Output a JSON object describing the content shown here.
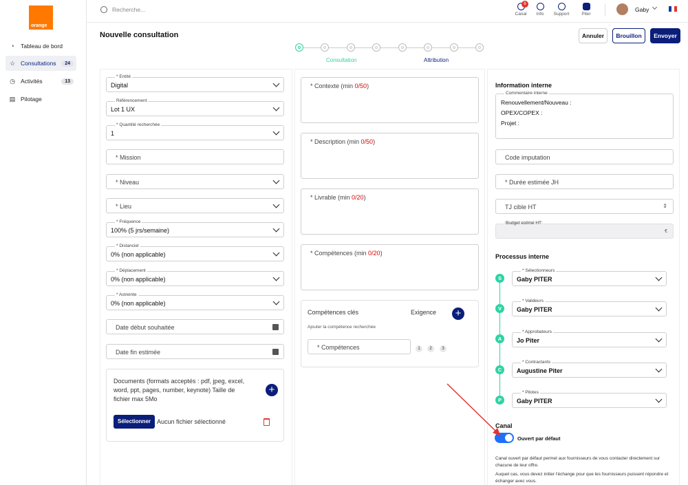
{
  "brand": {
    "logo_text": "orange",
    "color": "#ff7900"
  },
  "sidebar": {
    "items": [
      {
        "label": "Tableau de bord",
        "count": "",
        "icon": "gauge-icon"
      },
      {
        "label": "Consultations",
        "count": "24",
        "icon": "star-icon"
      },
      {
        "label": "Activités",
        "count": "13",
        "icon": "clock-icon"
      },
      {
        "label": "Pilotage",
        "count": "",
        "icon": "document-icon"
      }
    ]
  },
  "topbar": {
    "search_placeholder": "Recherche...",
    "icons": [
      {
        "label": "Canal",
        "badge": "6"
      },
      {
        "label": "Info"
      },
      {
        "label": "Support"
      },
      {
        "label": "Piter"
      }
    ],
    "user": "Gaby"
  },
  "header": {
    "title": "Nouvelle consultation",
    "cancel": "Annuler",
    "draft": "Brouillon",
    "send": "Envoyer"
  },
  "stepper": {
    "label1": "Consultation",
    "label2": "Attribution"
  },
  "left": {
    "entite": {
      "label": "* Entité",
      "value": "Digital"
    },
    "referencement": {
      "label": "Référencement",
      "value": "Lot 1 UX"
    },
    "quantite": {
      "label": "* Quantité recherchée",
      "value": "1"
    },
    "mission": "* Mission",
    "niveau": "* Niveau",
    "lieu": "* Lieu",
    "frequence": {
      "label": "* Fréquence",
      "value": "100% (5 jrs/semaine)"
    },
    "distanciel": {
      "label": "* Distanciel",
      "value": "0% (non applicable)"
    },
    "deplacement": {
      "label": "* Déplacement",
      "value": "0% (non applicable)"
    },
    "astreinte": {
      "label": "* Astreinte",
      "value": "0% (non applicable)"
    },
    "date_debut": "Date début souhaitée",
    "date_fin": "Date fin estimée",
    "documents": "Documents (formats acceptés : pdf, jpeg, excel, word, ppt, pages, number, keynote) Taille de fichier max 5Mo",
    "select_button": "Sélectionner",
    "no_file": "Aucun fichier sélectionné"
  },
  "middle": {
    "contexte": {
      "label": "* Contexte (min ",
      "count": "0/50",
      "close": ")"
    },
    "description": {
      "label": "* Description (min ",
      "count": "0/50",
      "close": ")"
    },
    "livrable": {
      "label": "* Livrable (min ",
      "count": "0/20",
      "close": ")"
    },
    "competences": {
      "label": "* Compétences (min ",
      "count": "0/20",
      "close": ")"
    },
    "cles_title": "Compétences clés",
    "exigence": "Exigence",
    "hint": "Ajouter la compétence recherchée",
    "comp_field": "* Compétences",
    "levels": [
      "1",
      "2",
      "3"
    ]
  },
  "right": {
    "info_title": "Information interne",
    "comment_label": "Commentaire interne",
    "comment_lines": [
      "Renouvellement/Nouveau :",
      "OPEX/COPEX :",
      "Projet :"
    ],
    "code_imputation": "Code imputation",
    "duree": "* Durée estimée JH",
    "tj": "TJ cible HT",
    "budget_label": "Budget estimé HT",
    "budget_unit": "€",
    "process_title": "Processus interne",
    "roles": [
      {
        "letter": "S",
        "label": "* Sélectionneurs",
        "value": "Gaby PITER"
      },
      {
        "letter": "V",
        "label": "* Valideurs",
        "value": "Gaby PITER"
      },
      {
        "letter": "A",
        "label": "* Approbateurs",
        "value": "Jo Piter"
      },
      {
        "letter": "C",
        "label": "* Contractants",
        "value": "Augustine Piter"
      },
      {
        "letter": "P",
        "label": "* Pilotes",
        "value": "Gaby PITER"
      }
    ],
    "canal_title": "Canal",
    "toggle_label": "Ouvert par défaut",
    "canal_desc1": "Canal ouvert par défaut permet aux fournisseurs de vous contacter directement sur chacune de leur offre.",
    "canal_desc2": "Auquel cas, vous devez initier l'échange pour que les fournisseurs puissent répondre et échanger avec vous."
  }
}
